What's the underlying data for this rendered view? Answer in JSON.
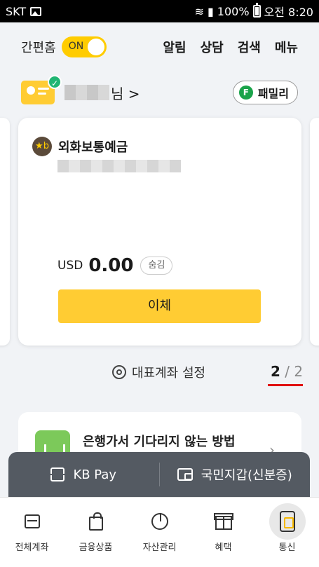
{
  "statusbar": {
    "carrier": "SKT",
    "battery": "100%",
    "time": "오전 8:20"
  },
  "header": {
    "simple_home_label": "간편홈",
    "toggle_state": "ON",
    "nav": [
      "알림",
      "상담",
      "검색",
      "메뉴"
    ]
  },
  "user": {
    "suffix": "님 >",
    "family_badge": "F",
    "family_label": "패밀리"
  },
  "account_card": {
    "logo": "★b",
    "name": "외화보통예금",
    "currency": "USD",
    "balance": "0.00",
    "hide_label": "숨김",
    "transfer_label": "이체"
  },
  "card_footer": {
    "settings_label": "대표계좌 설정",
    "page_current": "2",
    "page_rest": " / 2"
  },
  "promo": {
    "text": "은행가서 기다리지 않는 방법",
    "chevron": "›"
  },
  "paybar": {
    "kb_pay": "KB Pay",
    "id_wallet": "국민지갑(신분증)"
  },
  "tabs": [
    {
      "label": "전체계좌",
      "icon": "account-icon"
    },
    {
      "label": "금융상품",
      "icon": "shopping-bag-icon"
    },
    {
      "label": "자산관리",
      "icon": "pie-chart-icon"
    },
    {
      "label": "혜택",
      "icon": "gift-icon"
    },
    {
      "label": "통신",
      "icon": "phone-icon"
    }
  ],
  "colors": {
    "accent": "#ffcc33",
    "pager_underline": "#e01010",
    "paybar_bg": "#545a62"
  }
}
